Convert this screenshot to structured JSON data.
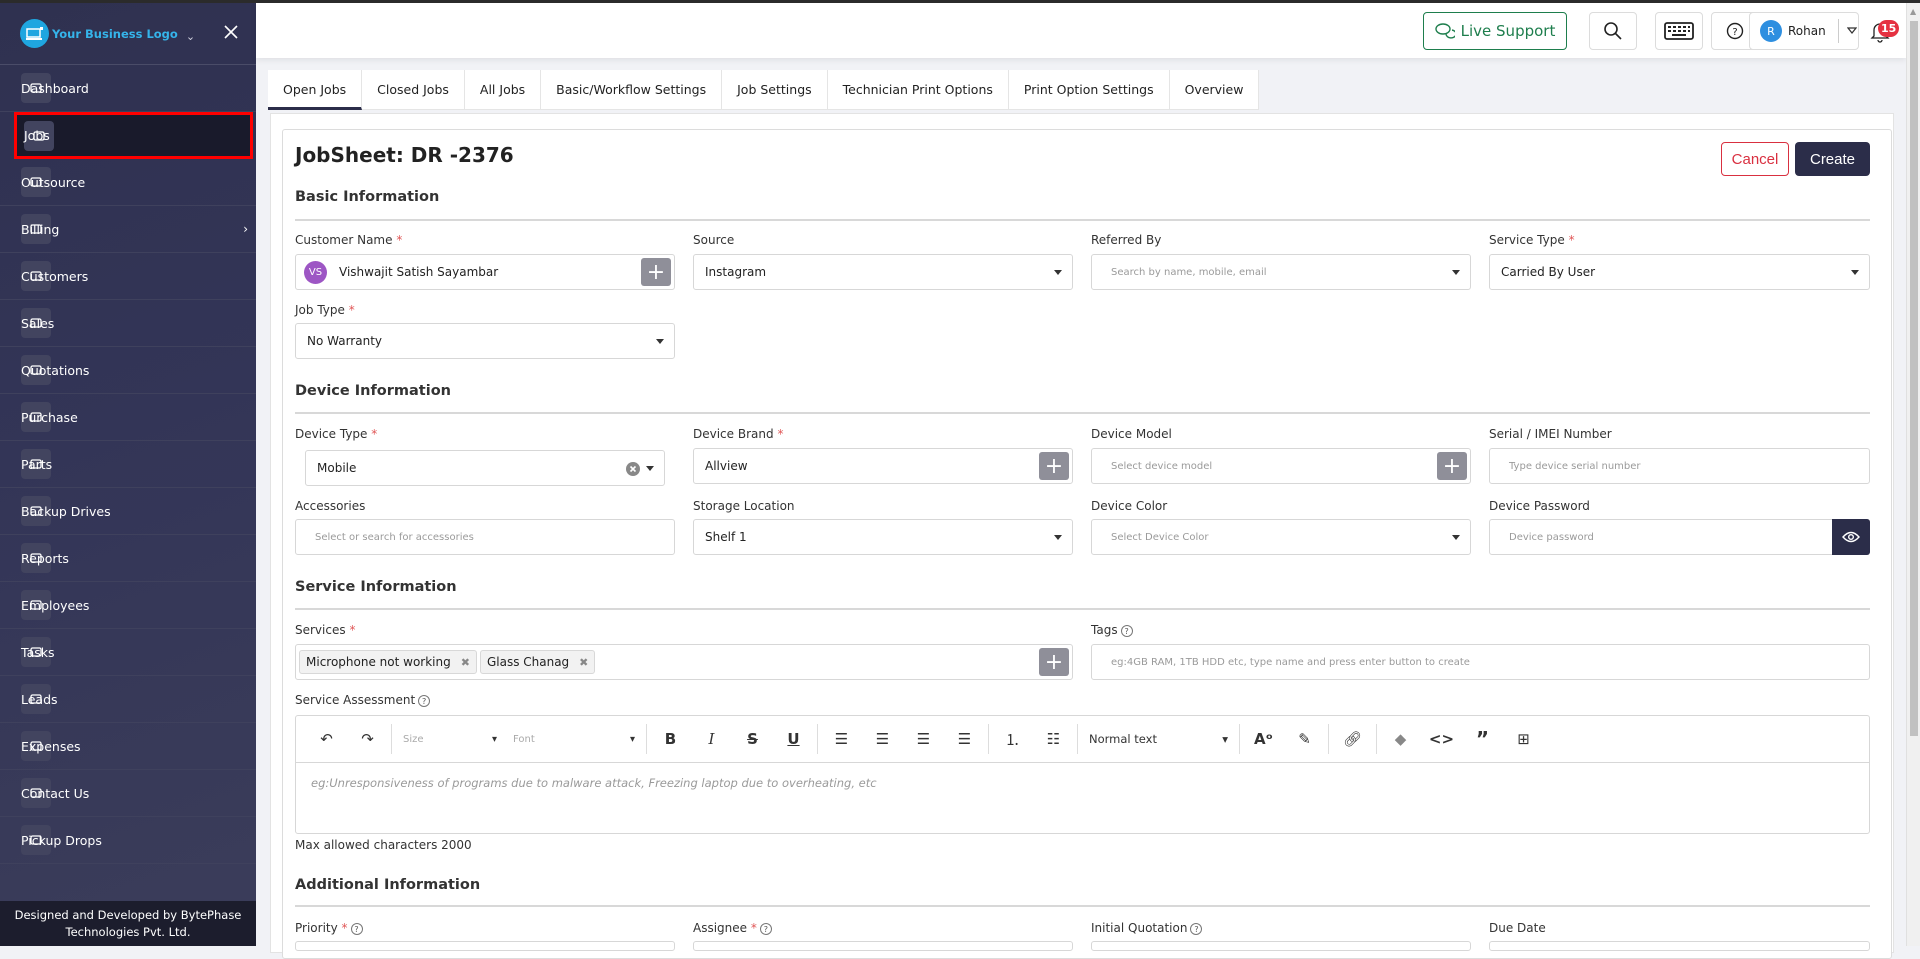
{
  "sidebar": {
    "logo_text": "Your Business Logo",
    "items": [
      {
        "label": "Dashboard",
        "icon": "dashboard-icon"
      },
      {
        "label": "Jobs",
        "icon": "ticket-icon",
        "active": true
      },
      {
        "label": "Outsource",
        "icon": "outsource-icon"
      },
      {
        "label": "Billing",
        "icon": "wallet-icon",
        "has_submenu": true
      },
      {
        "label": "Customers",
        "icon": "users-icon"
      },
      {
        "label": "Sales",
        "icon": "store-icon"
      },
      {
        "label": "Quotations",
        "icon": "document-icon"
      },
      {
        "label": "Purchase",
        "icon": "cart-icon"
      },
      {
        "label": "Parts",
        "icon": "tools-icon"
      },
      {
        "label": "Backup Drives",
        "icon": "database-icon"
      },
      {
        "label": "Reports",
        "icon": "chart-icon"
      },
      {
        "label": "Employees",
        "icon": "employee-icon"
      },
      {
        "label": "Tasks",
        "icon": "tasks-icon"
      },
      {
        "label": "Leads",
        "icon": "user-plus-icon"
      },
      {
        "label": "Expenses",
        "icon": "rupee-icon"
      },
      {
        "label": "Contact Us",
        "icon": "contact-card-icon"
      },
      {
        "label": "Pickup Drops",
        "icon": "pickup-icon"
      }
    ],
    "footer_line1": "Designed and Developed by BytePhase",
    "footer_line2": "Technologies Pvt. Ltd."
  },
  "topbar": {
    "live_support": "Live Support",
    "user_initial": "R",
    "user_name": "Rohan",
    "notification_count": "15"
  },
  "tabs": [
    "Open Jobs",
    "Closed Jobs",
    "All Jobs",
    "Basic/Workflow Settings",
    "Job Settings",
    "Technician Print Options",
    "Print Option Settings",
    "Overview"
  ],
  "form": {
    "title": "JobSheet: DR -2376",
    "cancel": "Cancel",
    "create": "Create",
    "basic": {
      "heading": "Basic Information",
      "customer_label": "Customer Name",
      "customer_initials": "VS",
      "customer_value": "Vishwajit Satish Sayambar",
      "source_label": "Source",
      "source_value": "Instagram",
      "referred_label": "Referred By",
      "referred_placeholder": "Search by name, mobile, email",
      "service_type_label": "Service Type",
      "service_type_value": "Carried By User",
      "job_type_label": "Job Type",
      "job_type_value": "No Warranty"
    },
    "device": {
      "heading": "Device Information",
      "type_label": "Device Type",
      "type_value": "Mobile",
      "brand_label": "Device Brand",
      "brand_value": "Allview",
      "model_label": "Device Model",
      "model_placeholder": "Select device model",
      "serial_label": "Serial / IMEI Number",
      "serial_placeholder": "Type device serial number",
      "accessories_label": "Accessories",
      "accessories_placeholder": "Select or search for accessories",
      "storage_label": "Storage Location",
      "storage_value": "Shelf 1",
      "color_label": "Device Color",
      "color_placeholder": "Select Device Color",
      "password_label": "Device Password",
      "password_placeholder": "Device password"
    },
    "service": {
      "heading": "Service Information",
      "services_label": "Services",
      "services": [
        "Microphone not working",
        "Glass Chanag"
      ],
      "tags_label": "Tags",
      "tags_placeholder": "eg:4GB RAM, 1TB HDD etc, type name and press enter button to create",
      "assessment_label": "Service Assessment",
      "size_label": "Size",
      "font_label": "Font",
      "text_style": "Normal text",
      "assessment_placeholder": "eg:Unresponsiveness of programs due to malware attack, Freezing laptop due to overheating, etc",
      "max_chars": "Max allowed characters 2000"
    },
    "additional": {
      "heading": "Additional Information",
      "priority_label": "Priority",
      "assignee_label": "Assignee",
      "quotation_label": "Initial Quotation",
      "due_label": "Due Date"
    }
  }
}
